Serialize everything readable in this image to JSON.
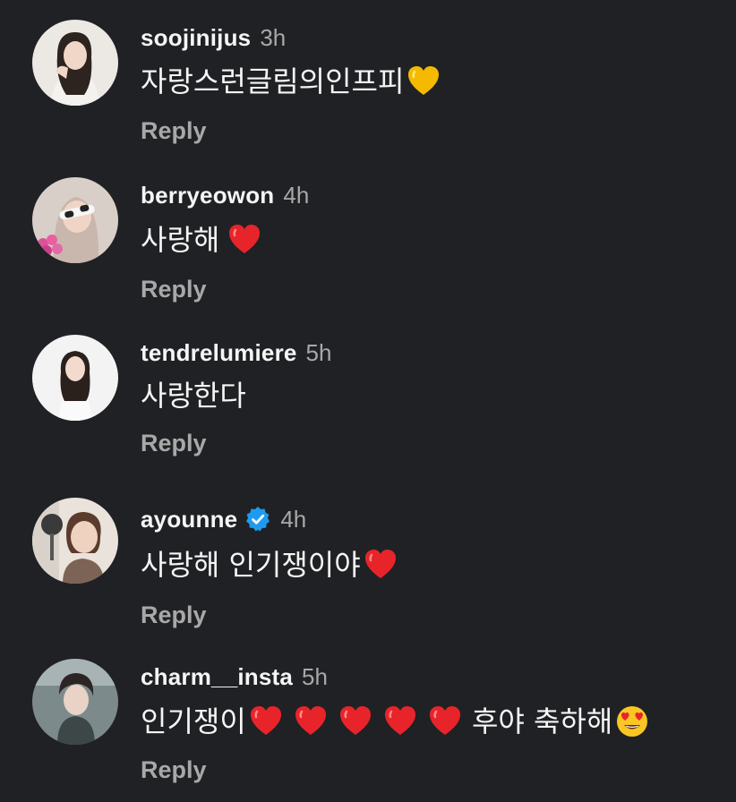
{
  "comments": [
    {
      "username": "soojinijus",
      "time": "3h",
      "text_before": "자랑스런글림의인프피",
      "emojis_after": [
        "yellow-heart"
      ],
      "reply_label": "Reply",
      "verified": false
    },
    {
      "username": "berryeowon",
      "time": "4h",
      "text_before": "사랑해 ",
      "emojis_after": [
        "red-heart"
      ],
      "reply_label": "Reply",
      "verified": false
    },
    {
      "username": "tendrelumiere",
      "time": "5h",
      "text_before": "사랑한다",
      "emojis_after": [],
      "reply_label": "Reply",
      "verified": false
    },
    {
      "username": "ayounne",
      "time": "4h",
      "text_before": "사랑해 인기쟁이야",
      "emojis_after": [
        "red-heart"
      ],
      "reply_label": "Reply",
      "verified": true
    },
    {
      "username": "charm__insta",
      "time": "5h",
      "text_before": "인기쟁이",
      "emojis_after": [
        "red-heart",
        "red-heart",
        "red-heart",
        "red-heart",
        "red-heart"
      ],
      "text_after": " 후야 축하해",
      "emojis_end": [
        "heart-eyes-face"
      ],
      "reply_label": "Reply",
      "verified": false
    }
  ],
  "colors": {
    "background": "#202124",
    "primary_text": "#f5f5f5",
    "secondary_text": "#a8a8a8",
    "verified_badge": "#1d9bf0",
    "red_heart": "#e8242b",
    "yellow_heart": "#f5b900"
  }
}
